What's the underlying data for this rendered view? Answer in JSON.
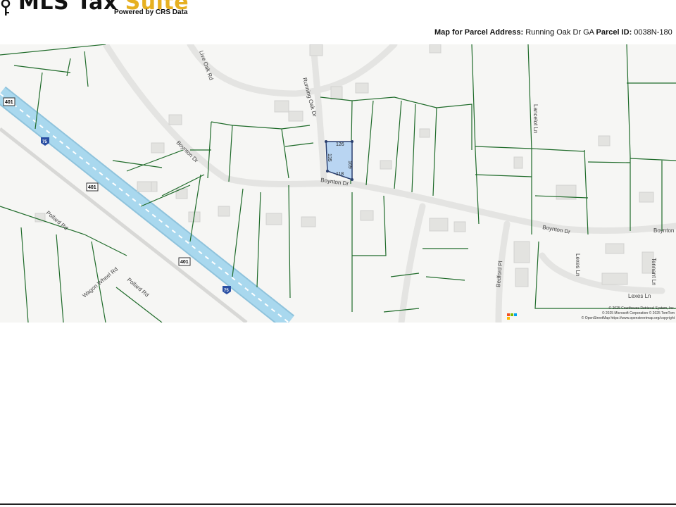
{
  "header": {
    "logo_main": "MLS Tax ",
    "logo_accent": "Suite",
    "logo_sub": "Powered by CRS Data",
    "map_for_label": "Map for Parcel Address:",
    "address": "Running Oak Dr GA",
    "parcel_label": "Parcel ID:",
    "parcel_id": "0038N-180"
  },
  "map": {
    "roads": {
      "boynton": "Boynton Dr",
      "running_oak": "Running Oak Dr",
      "live_oak": "Live Oak Rd",
      "lancelot": "Lancelot Ln",
      "pollard": "Pollard Rd",
      "wagon_wheel": "Wagon Wheel Rd",
      "bedford": "Bedford Pl",
      "lexes": "Lexes Ln",
      "tennant": "Tennant Ln",
      "hwy_401": "401",
      "i75": "75"
    },
    "parcel_dims": [
      "126",
      "169",
      "135",
      "118"
    ],
    "attribution": [
      "© 2025 Courthouse Retrieval System, Inc.",
      "© 2025 Microsoft Corporation © 2025 TomTom",
      "© OpenStreetMap https://www.openstreetmap.org/copyright"
    ],
    "colors": {
      "parcel_line": "#1f6b2a",
      "highway": "#a9d8ee",
      "subject_fill": "#b9d5f2"
    }
  }
}
